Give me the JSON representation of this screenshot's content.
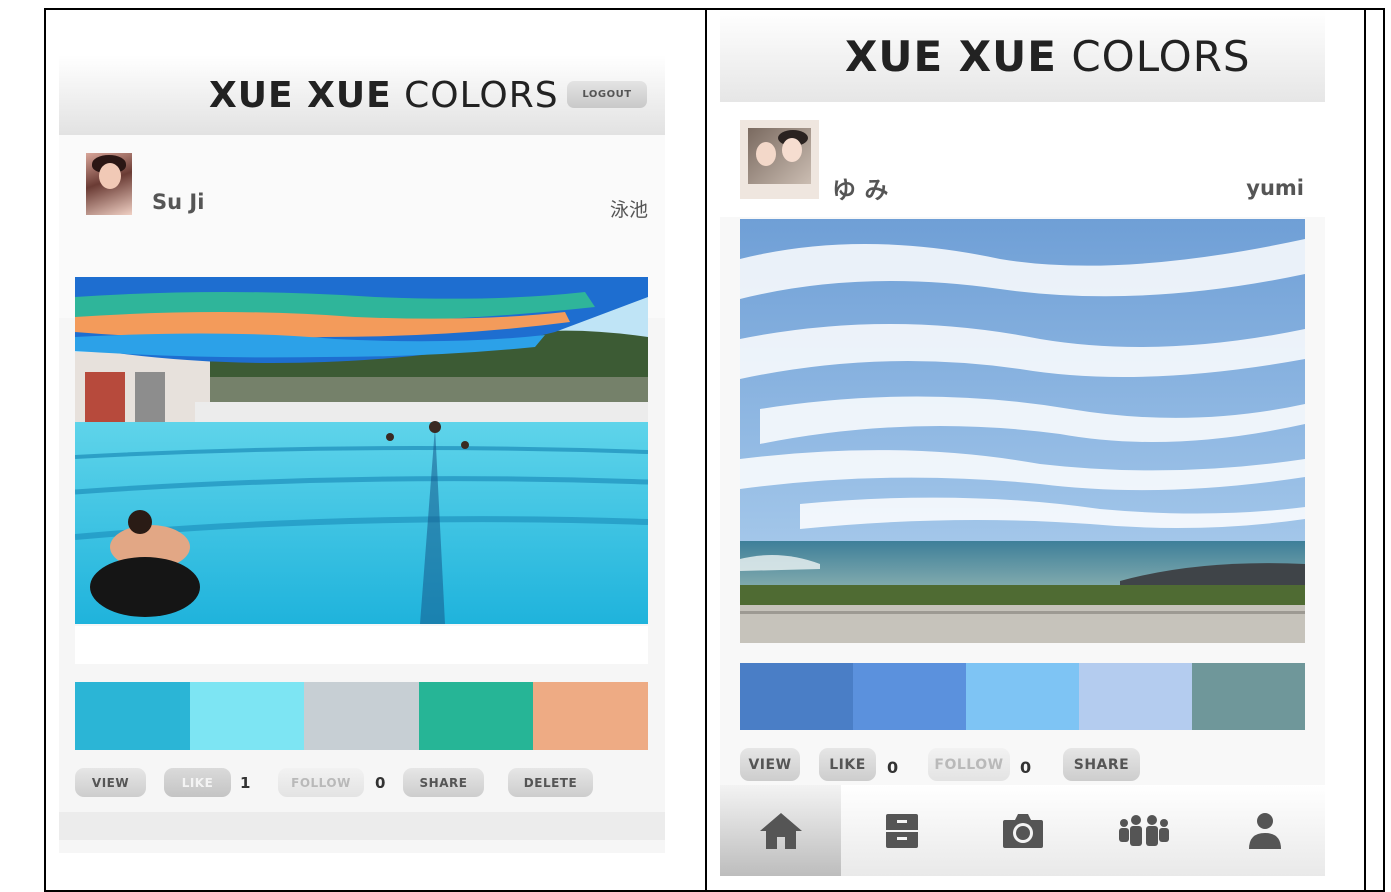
{
  "left": {
    "logo_bold": "XUE XUE",
    "logo_light": "COLORS",
    "logout_label": "LOGOUT",
    "user_name": "Su Ji",
    "location": "泳池",
    "palette": [
      "#2bb5d6",
      "#7de5f3",
      "#c7cfd4",
      "#26b596",
      "#eeab84"
    ],
    "buttons": {
      "view": "VIEW",
      "like": "LIKE",
      "like_count": "1",
      "follow": "FOLLOW",
      "follow_count": "0",
      "share": "SHARE",
      "delete": "DELETE"
    }
  },
  "right": {
    "logo_bold": "XUE XUE",
    "logo_light": "COLORS",
    "display_name": "ゆ み",
    "username": "yumi",
    "palette": [
      "#4a7ec6",
      "#5b91dd",
      "#7ec4f4",
      "#b4ccef",
      "#6f979a"
    ],
    "buttons": {
      "view": "VIEW",
      "like": "LIKE",
      "like_count": "0",
      "follow": "FOLLOW",
      "follow_count": "0",
      "share": "SHARE"
    },
    "nav": [
      "home-icon",
      "archive-icon",
      "camera-icon",
      "group-icon",
      "profile-icon"
    ]
  }
}
